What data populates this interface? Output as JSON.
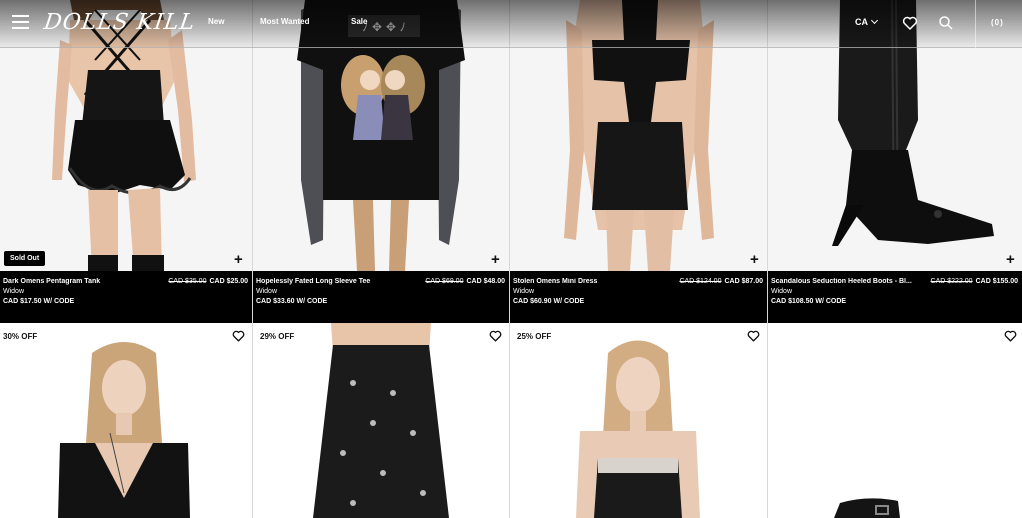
{
  "header": {
    "logo": "DOLLS KILL",
    "nav": [
      "New",
      "Most Wanted",
      "Sale"
    ],
    "region": "CA",
    "cart_label": "(0)"
  },
  "products_top": [
    {
      "name": "Dark Omens Pentagram Tank",
      "original_price": "CAD $35.00",
      "price": "CAD $25.00",
      "brand": "Widow",
      "code_price": "CAD $17.50 W/ CODE",
      "badge": "Sold Out",
      "image_desc": "black pentagram tank with ruffle shorts"
    },
    {
      "name": "Hopelessly Fated Long Sleeve Tee",
      "original_price": "CAD $69.00",
      "price": "CAD $48.00",
      "brand": "Widow",
      "code_price": "CAD $33.60 W/ CODE",
      "image_desc": "black graphic long sleeve tee"
    },
    {
      "name": "Stolen Omens Mini Dress",
      "original_price": "CAD $124.00",
      "price": "CAD $87.00",
      "brand": "Widow",
      "code_price": "CAD $60.90 W/ CODE",
      "image_desc": "black cross cutout mini dress"
    },
    {
      "name": "Scandalous Seduction Heeled Boots - Bl...",
      "original_price": "CAD $222.00",
      "price": "CAD $155.00",
      "brand": "Widow",
      "code_price": "CAD $108.50 W/ CODE",
      "image_desc": "black lace-up stiletto knee boot"
    }
  ],
  "products_bottom": [
    {
      "badge": "30% OFF"
    },
    {
      "badge": "29% OFF"
    },
    {
      "badge": "25% OFF"
    },
    {
      "badge": ""
    }
  ],
  "colors": {
    "accent": "#000000",
    "page": "#ffffff"
  }
}
